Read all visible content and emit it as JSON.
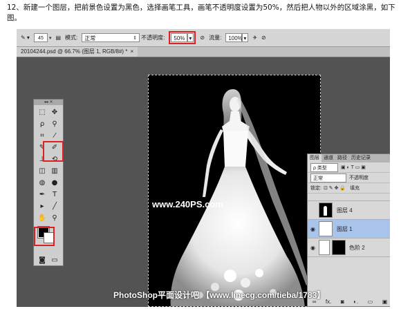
{
  "instruction": "12、新建一个图层，把前景色设置为黑色，选择画笔工具，画笔不透明度设置为50%，然后把人物以外的区域涂黑，如下图。",
  "options_bar": {
    "brush_size": "45",
    "mode_label": "模式:",
    "mode_value": "正常",
    "opacity_label": "不透明度:",
    "opacity_value": "50%",
    "flow_label": "流量:",
    "flow_value": "100%"
  },
  "document_tab": {
    "title": "20104244.psd @ 66.7% (图层 1, RGB/8#) *",
    "close": "×"
  },
  "watermarks": {
    "site": "www.240PS.com",
    "credit": "PhotoShop平面设计吧 【www.linecg.com/tieba/1783】"
  },
  "toolbox": {
    "header": "◂◂ ✕",
    "foreground_color": "#000000",
    "background_color": "#ffffff",
    "tools": [
      {
        "name": "marquee-tool-icon",
        "glyph": "⬚"
      },
      {
        "name": "move-tool-icon",
        "glyph": "✥"
      },
      {
        "name": "lasso-tool-icon",
        "glyph": "ρ"
      },
      {
        "name": "quick-select-icon",
        "glyph": "⚲"
      },
      {
        "name": "crop-tool-icon",
        "glyph": "⌗"
      },
      {
        "name": "eyedropper-icon",
        "glyph": "⁄"
      },
      {
        "name": "healing-brush-icon",
        "glyph": "✎"
      },
      {
        "name": "brush-tool-icon",
        "glyph": "✐"
      },
      {
        "name": "clone-stamp-icon",
        "glyph": "⊥"
      },
      {
        "name": "history-brush-icon",
        "glyph": "⟲"
      },
      {
        "name": "eraser-icon",
        "glyph": "◫"
      },
      {
        "name": "gradient-icon",
        "glyph": "▥"
      },
      {
        "name": "blur-icon",
        "glyph": "◍"
      },
      {
        "name": "dodge-icon",
        "glyph": "●"
      },
      {
        "name": "pen-tool-icon",
        "glyph": "✒"
      },
      {
        "name": "type-tool-icon",
        "glyph": "T"
      },
      {
        "name": "path-select-icon",
        "glyph": "▸"
      },
      {
        "name": "line-tool-icon",
        "glyph": "╱"
      },
      {
        "name": "hand-tool-icon",
        "glyph": "✋"
      },
      {
        "name": "zoom-tool-icon",
        "glyph": "⚲"
      }
    ]
  },
  "layers_panel": {
    "tabs": [
      "图层",
      "通道",
      "路径",
      "历史记录"
    ],
    "filter_label": "ρ 类型",
    "blend_mode": "正常",
    "opacity_label": "不透明度",
    "lock_label": "锁定:",
    "fill_label": "填充",
    "layers": [
      {
        "name": "图层 4",
        "selected": false,
        "visible": false,
        "type": "pixel"
      },
      {
        "name": "图层 1",
        "selected": true,
        "visible": true,
        "type": "pixel"
      },
      {
        "name": "色阶 2",
        "selected": false,
        "visible": true,
        "type": "adjustment"
      }
    ],
    "bottom_icons": [
      "∞",
      "fx.",
      "◙",
      "◐.",
      "▭",
      "▣"
    ]
  }
}
